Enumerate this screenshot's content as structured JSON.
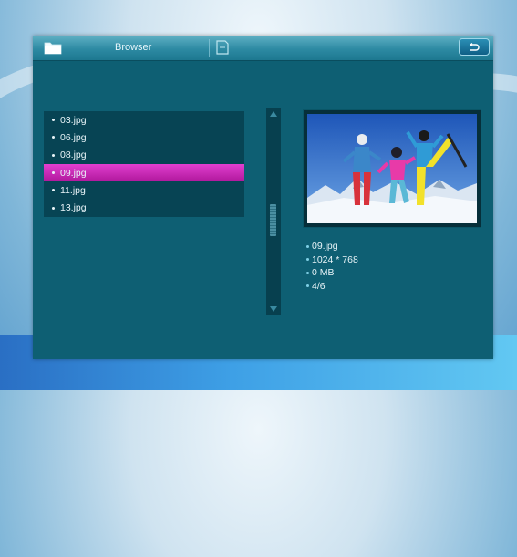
{
  "window": {
    "title": "Browser",
    "back_icon": "return-icon",
    "folder_icon": "folder-icon",
    "card_icon": "memory-card-icon"
  },
  "files": [
    {
      "name": "03.jpg",
      "selected": false
    },
    {
      "name": "06.jpg",
      "selected": false
    },
    {
      "name": "08.jpg",
      "selected": false
    },
    {
      "name": "09.jpg",
      "selected": true
    },
    {
      "name": "11.jpg",
      "selected": false
    },
    {
      "name": "13.jpg",
      "selected": false
    }
  ],
  "info": {
    "filename": "09.jpg",
    "resolution": "1024 * 768",
    "size": "0 MB",
    "position": "4/6"
  },
  "colors": {
    "panel": "#0e5f73",
    "selection": "#c62bb6",
    "list_bg": "#074454"
  }
}
